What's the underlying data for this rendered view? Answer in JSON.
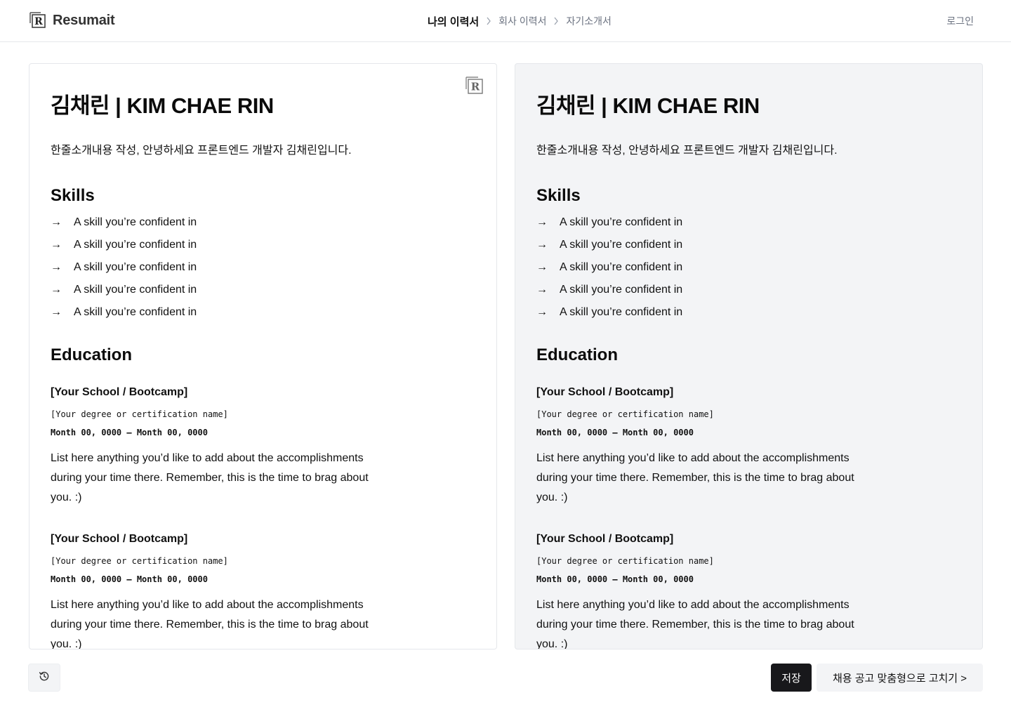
{
  "header": {
    "brand": "Resumait",
    "breadcrumbs": [
      "나의 이력서",
      "회사 이력서",
      "자기소개서"
    ],
    "login_label": "로그인"
  },
  "resume": {
    "name": "김채린 | KIM CHAE RIN",
    "intro": "한줄소개내용 작성, 안녕하세요 프론트엔드 개발자 김채린입니다.",
    "skills_heading": "Skills",
    "skills": [
      "A skill you’re confident in",
      "A skill you’re confident in",
      "A skill you’re confident in",
      "A skill you’re confident in",
      "A skill you’re confident in"
    ],
    "education_heading": "Education",
    "education": [
      {
        "school": "[Your School / Bootcamp]",
        "degree": "[Your degree or certification name]",
        "dates": "Month 00, 0000 — Month 00, 0000",
        "description": "List here anything you’d like to add about the accomplishments during your time there. Remember, this is the time to brag about you. :)"
      },
      {
        "school": "[Your School / Bootcamp]",
        "degree": "[Your degree or certification name]",
        "dates": "Month 00, 0000 — Month 00, 0000",
        "description": "List here anything you’d like to add about the accomplishments during your time there. Remember, this is the time to brag about you. :)"
      }
    ]
  },
  "footer": {
    "history_icon": "history-icon",
    "save_label": "저장",
    "tailor_label": "채용 공고 맞춤형으로 고치기 >"
  },
  "colors": {
    "save_button_bg": "#18181b",
    "right_panel_bg": "#f3f4f6",
    "border": "#e5e7eb"
  }
}
